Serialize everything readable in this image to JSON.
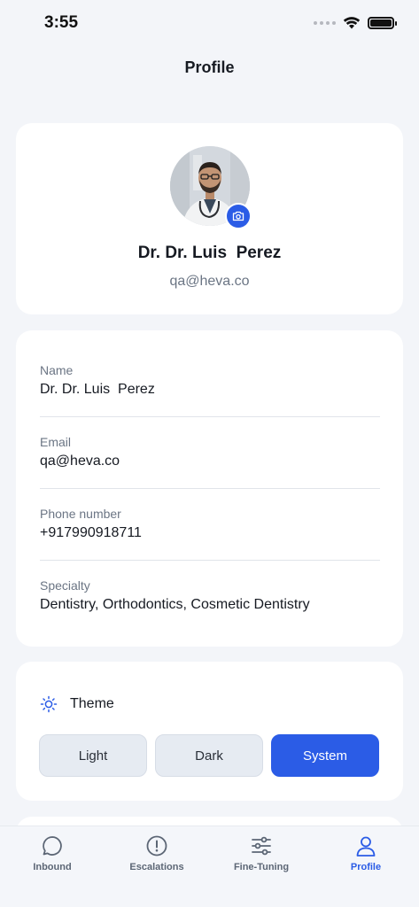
{
  "status_bar": {
    "time": "3:55"
  },
  "header": {
    "title": "Profile"
  },
  "profile": {
    "name": "Dr. Dr. Luis  Perez",
    "email": "qa@heva.co"
  },
  "details": {
    "fields": [
      {
        "label": "Name",
        "value": "Dr. Dr. Luis  Perez"
      },
      {
        "label": "Email",
        "value": "qa@heva.co"
      },
      {
        "label": "Phone number",
        "value": "+917990918711"
      },
      {
        "label": "Specialty",
        "value": "Dentistry, Orthodontics, Cosmetic Dentistry"
      }
    ]
  },
  "theme": {
    "label": "Theme",
    "options": [
      "Light",
      "Dark",
      "System"
    ],
    "selected": "System"
  },
  "tabs": [
    {
      "label": "Inbound",
      "icon": "chat-bubble-icon"
    },
    {
      "label": "Escalations",
      "icon": "alert-circle-icon"
    },
    {
      "label": "Fine-Tuning",
      "icon": "sliders-icon"
    },
    {
      "label": "Profile",
      "icon": "user-icon"
    }
  ],
  "active_tab": "Profile",
  "colors": {
    "accent": "#2b5ce6",
    "background": "#f3f5f9",
    "card": "#ffffff",
    "muted_text": "#6b7584"
  }
}
